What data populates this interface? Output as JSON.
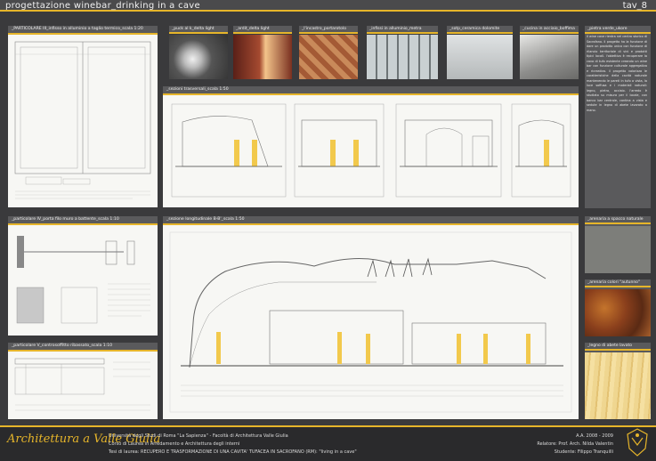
{
  "header": {
    "title": "progettazione winebar_drinking in a cave",
    "tav": "tav_8"
  },
  "panels": {
    "particolare_iii": "_PARTICOLARE III_infisso in alluminio a taglio termico_scala 1:20",
    "particolare_iv": "_particolare IV_porta filo muro a battente_scala 1:10",
    "particolare_v": "_particolare V_controsoffitto ribassato_scala 1:10",
    "sezioni_trasversali": "_sezioni trasversali_scala 1:50",
    "sezione_longitudinale": "_sezione longitudinale B-B'_scala 1:50"
  },
  "thumbnails": [
    {
      "label": "_puck al k_delta light",
      "color": "#6b6b6e"
    },
    {
      "label": "_ardit_delta light",
      "color": "#7a3a2a"
    },
    {
      "label": "_l'incastro_portarotolo",
      "color": "#b06a45"
    },
    {
      "label": "_infissi in alluminio_metra",
      "color": "#8a8f90"
    },
    {
      "label": "_sotp_ceramica dolomite",
      "color": "#c9cbcc"
    },
    {
      "label": "_cucina in acciaio_boffima",
      "color": "#9a9a98"
    }
  ],
  "sidebar": {
    "pietra_label": "_pietra verde_ukore",
    "pietra_text": "il wine cave rientra nel centro storico di Sacrofano. il progetto ha la funzione di dare un prodotto unico con funzione di rilancio territoriale di vini e prodotti tipici locali. l'obiettivo è recuperare la cava di tufo esistente creando un wine bar con funzione culturale aggregativa e ricreativa. il progetto valorizza le caratteristiche della cavità naturale mantenendo le pareti in tufo a vista, la luce soffusa e i materiali naturali: legno, pietra, acciaio. l'arredo è studiato su misura per il locale, con banco bar centrale, cantina a vista e sedute in legno di abete lavorato a mano.",
    "arenaria_label": "_arenaria a spacco naturale",
    "cotto_label": "_arenaria colori \"autunno\"",
    "abete_label": "_legno di abete lavato"
  },
  "footer": {
    "logo": "Architettura a Valle Giulia",
    "line1": "Università degli Studi di Roma \"La Sapienza\" - Facoltà di Architettura Valle Giulia",
    "line2": "Corso di Laurea in Arredamento e Architettura degli interni",
    "line3": "Tesi di laurea: RECUPERO E TRASFORMAZIONE DI UNA CAVITA' TUFACEA IN SACROFANO (RM): \"living in a cave\"",
    "year": "A.A. 2008 - 2009",
    "relatore": "Relatore: Prof. Arch. Nilda Valentin",
    "studente": "Studente: Filippo Tranquilli"
  },
  "colors": {
    "accent": "#e6b52a",
    "panel": "#5a5a5c",
    "background": "#3a3a3c"
  }
}
